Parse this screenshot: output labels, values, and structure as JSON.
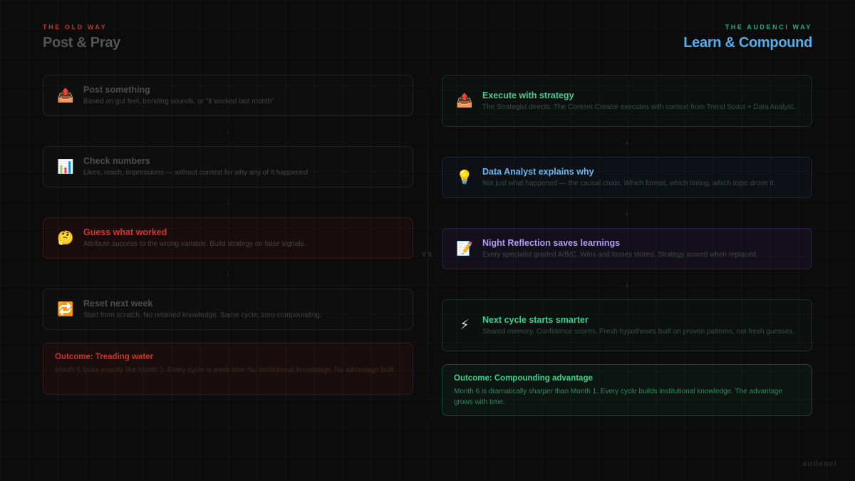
{
  "old_way": {
    "kicker": "THE OLD WAY",
    "title": "Post & Pray",
    "steps": [
      {
        "icon": "📤",
        "title": "Post something",
        "desc": "Based on gut feel, trending sounds, or \"it worked last month\""
      },
      {
        "icon": "📊",
        "title": "Check numbers",
        "desc": "Likes, reach, impressions — without context for why any of it happened"
      },
      {
        "icon": "🤔",
        "title": "Guess what worked",
        "desc": "Attribute success to the wrong variable. Build strategy on false signals."
      },
      {
        "icon": "🔁",
        "title": "Reset next week",
        "desc": "Start from scratch. No retained knowledge. Same cycle, zero compounding."
      }
    ],
    "outcome": {
      "title": "Outcome: Treading water",
      "desc": "Month 6 looks exactly like Month 1. Every cycle is week one. No institutional knowledge. No advantage built."
    }
  },
  "new_way": {
    "kicker": "THE AUDENCI WAY",
    "title": "Learn & Compound",
    "steps": [
      {
        "icon": "📤",
        "title": "Execute with strategy",
        "desc": "The Strategist directs. The Content Creator executes with context from Trend Scout + Data Analyst."
      },
      {
        "icon": "💡",
        "title": "Data Analyst explains why",
        "desc": "Not just what happened — the causal chain. Which format, which timing, which topic drove it."
      },
      {
        "icon": "📝",
        "title": "Night Reflection saves learnings",
        "desc": "Every specialist graded A/B/C. Wins and losses stored. Strategy scored when replaced."
      },
      {
        "icon": "⚡",
        "title": "Next cycle starts smarter",
        "desc": "Shared memory. Confidence scores. Fresh hypotheses built on proven patterns, not fresh guesses."
      }
    ],
    "outcome": {
      "title": "Outcome: Compounding advantage",
      "desc": "Month 6 is dramatically sharper than Month 1. Every cycle builds institutional knowledge. The advantage grows with time."
    }
  },
  "arrow": "↓",
  "vs": "VS",
  "brand": "audenci",
  "colors": {
    "old_accent": "#c0392b",
    "new_kicker": "#22b07d",
    "new_title": "#5aaee8",
    "green_accent": "#3ecf8e",
    "blue_accent": "#6ab8ef",
    "purple_accent": "#b29bf0"
  }
}
